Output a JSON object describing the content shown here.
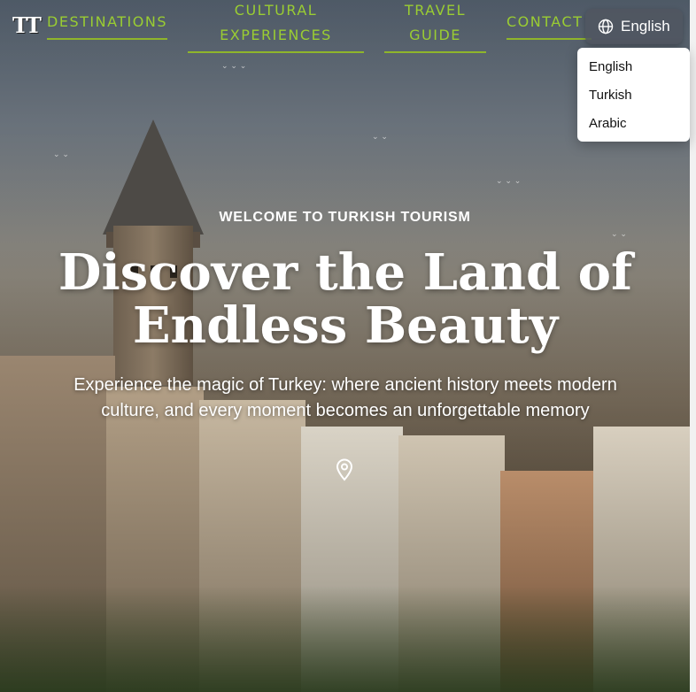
{
  "logo": {
    "text": "TT"
  },
  "nav": {
    "destinations": "DESTINATIONS",
    "cultural_line1": "CULTURAL",
    "cultural_line2": "EXPERIENCES",
    "travel_line1": "TRAVEL",
    "travel_line2": "GUIDE",
    "contact": "CONTACT"
  },
  "language": {
    "selected": "English",
    "icon": "globe-icon",
    "options": [
      "English",
      "Turkish",
      "Arabic"
    ]
  },
  "hero": {
    "kicker": "WELCOME TO TURKISH TOURISM",
    "headline_line1": "Discover the Land of",
    "headline_line2": "Endless Beauty",
    "subtext_line1": "Experience the magic of Turkey: where ancient history meets modern",
    "subtext_line2": "culture, and every moment becomes an unforgettable memory",
    "location_icon": "map-pin-icon"
  },
  "colors": {
    "nav_accent": "#9acd32",
    "text": "#ffffff"
  }
}
